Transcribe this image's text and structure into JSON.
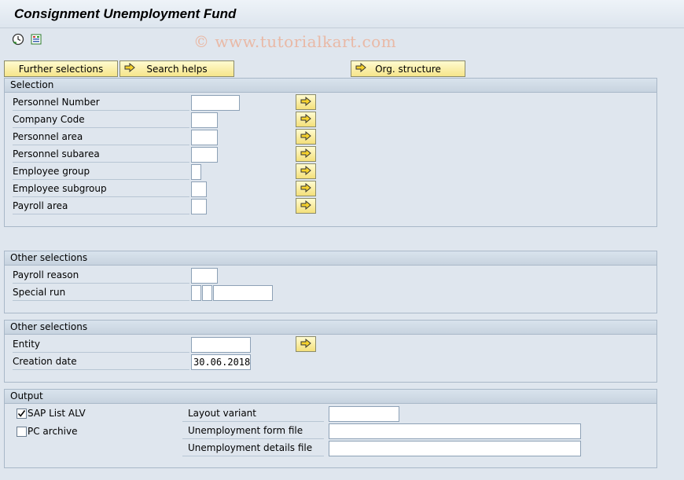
{
  "window": {
    "title": "Consignment Unemployment Fund"
  },
  "toolbar": {
    "execute_icon": "execute-clock-icon",
    "variant_icon": "get-variant-icon"
  },
  "watermark": "© www.tutorialkart.com",
  "buttons": {
    "further_selections": "Further selections",
    "search_helps": "Search helps",
    "org_structure": "Org. structure"
  },
  "selection": {
    "title": "Selection",
    "rows": [
      {
        "label": "Personnel Number",
        "value": ""
      },
      {
        "label": "Company Code",
        "value": ""
      },
      {
        "label": "Personnel area",
        "value": ""
      },
      {
        "label": "Personnel subarea",
        "value": ""
      },
      {
        "label": "Employee group",
        "value": ""
      },
      {
        "label": "Employee subgroup",
        "value": ""
      },
      {
        "label": "Payroll area",
        "value": ""
      }
    ]
  },
  "other1": {
    "title": "Other selections",
    "rows": [
      {
        "label": "Payroll reason",
        "value": ""
      },
      {
        "label": "Special run",
        "value": ""
      }
    ]
  },
  "other2": {
    "title": "Other selections",
    "rows": [
      {
        "label": "Entity",
        "value": ""
      },
      {
        "label": "Creation date",
        "value": "30.06.2018"
      }
    ]
  },
  "output": {
    "title": "Output",
    "sap_list_alv": {
      "label": "SAP List ALV",
      "checked": true
    },
    "pc_archive": {
      "label": "PC archive",
      "checked": false
    },
    "layout_variant": {
      "label": "Layout variant",
      "value": ""
    },
    "unemployment_form_file": {
      "label": "Unemployment form file",
      "value": ""
    },
    "unemployment_details_file": {
      "label": "Unemployment details file",
      "value": ""
    }
  }
}
